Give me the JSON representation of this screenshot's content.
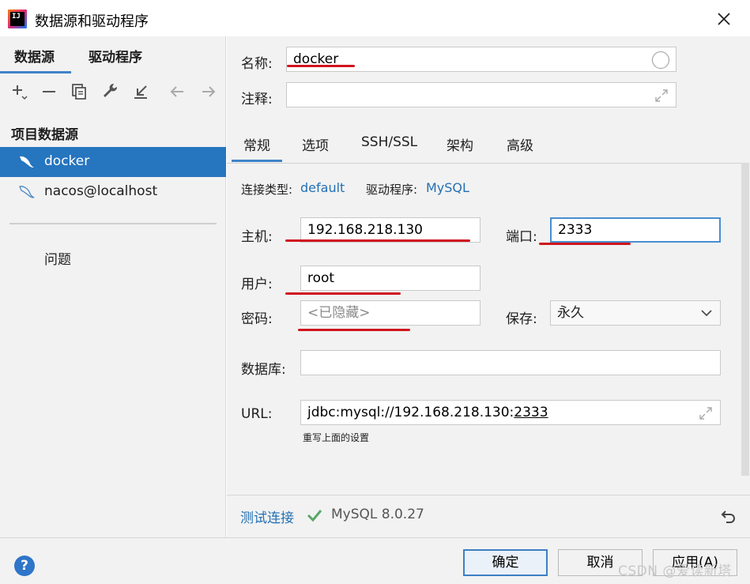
{
  "window": {
    "title": "数据源和驱动程序",
    "app_icon_text": "IJ"
  },
  "left": {
    "tabs": [
      {
        "label": "数据源",
        "active": true
      },
      {
        "label": "驱动程序",
        "active": false
      }
    ],
    "toolbar_icons": [
      "add-icon",
      "remove-icon",
      "copy-icon",
      "wrench-icon",
      "import-icon",
      "back-arrow-icon",
      "forward-arrow-icon"
    ],
    "section_title": "项目数据源",
    "datasources": [
      {
        "label": "docker",
        "selected": true
      },
      {
        "label": "nacos@localhost",
        "selected": false
      }
    ],
    "problems_label": "问题"
  },
  "right": {
    "name_label": "名称:",
    "name_value": "docker",
    "comment_label": "注释:",
    "comment_value": "",
    "tabs": [
      {
        "label": "常规",
        "active": true
      },
      {
        "label": "选项",
        "active": false
      },
      {
        "label": "SSH/SSL",
        "active": false
      },
      {
        "label": "架构",
        "active": false
      },
      {
        "label": "高级",
        "active": false
      }
    ],
    "connection_type_label": "连接类型:",
    "connection_type_value": "default",
    "driver_label": "驱动程序:",
    "driver_value": "MySQL",
    "host_label": "主机:",
    "host_value": "192.168.218.130",
    "port_label": "端口:",
    "port_value": "2333",
    "user_label": "用户:",
    "user_value": "root",
    "password_label": "密码:",
    "password_placeholder": "<已隐藏>",
    "save_label": "保存:",
    "save_value": "永久",
    "database_label": "数据库:",
    "database_value": "",
    "url_label": "URL:",
    "url_prefix": "jdbc:mysql://192.168.218.130:",
    "url_port": "2333",
    "url_hint": "重写上面的设置",
    "test_connection": "测试连接",
    "test_result": "MySQL 8.0.27"
  },
  "footer": {
    "help": "?",
    "ok": "确定",
    "cancel": "取消",
    "apply": "应用(A)",
    "watermark": "CSDN @爱读新塔"
  },
  "colors": {
    "accent": "#2675bf",
    "link": "#2470b3",
    "underline_red": "#d0151f",
    "check_green": "#59a869"
  }
}
